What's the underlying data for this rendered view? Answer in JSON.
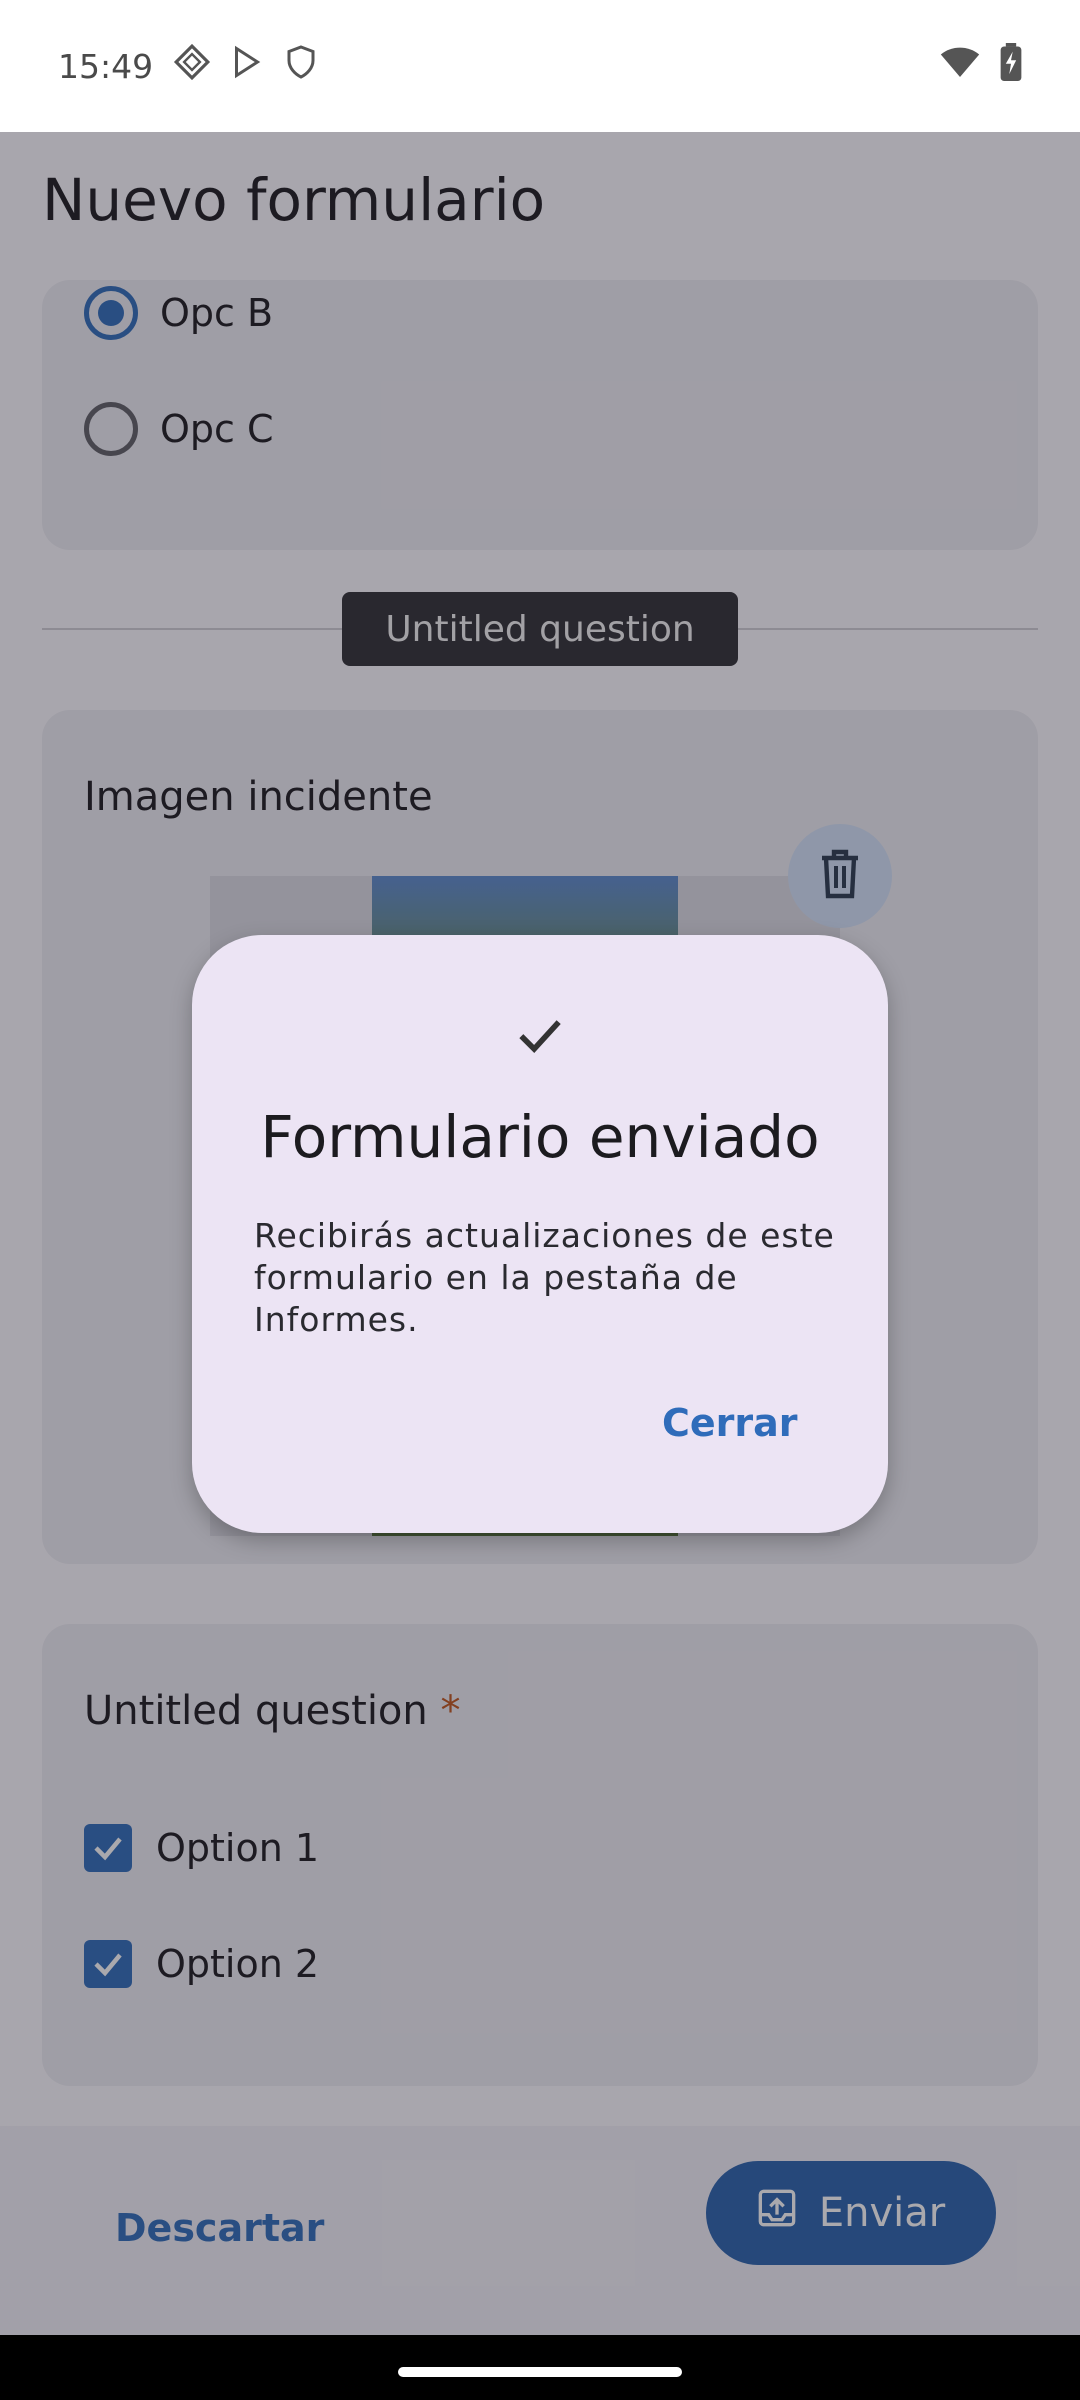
{
  "status_bar": {
    "time": "15:49",
    "icons": [
      "diamond-icon",
      "play-store-icon",
      "shield-icon",
      "wifi-icon",
      "battery-icon"
    ]
  },
  "app": {
    "title": "Nuevo formulario"
  },
  "radio_question": {
    "options": [
      {
        "label": "Opc B",
        "selected": true
      },
      {
        "label": "Opc C",
        "selected": false
      }
    ]
  },
  "section_chip": {
    "label": "Untitled question"
  },
  "image_question": {
    "title": "Imagen incidente",
    "delete_icon": "trash-icon"
  },
  "checkbox_question": {
    "title": "Untitled question",
    "required_mark": "*",
    "options": [
      {
        "label": "Option 1",
        "checked": true
      },
      {
        "label": "Option 2",
        "checked": true
      }
    ]
  },
  "bottom_bar": {
    "discard_label": "Descartar",
    "send_label": "Enviar",
    "send_icon": "upload-icon"
  },
  "dialog": {
    "icon": "check-icon",
    "title": "Formulario enviado",
    "body": "Recibirás actualizaciones de este formulario en la pestaña de Informes.",
    "close_label": "Cerrar"
  },
  "colors": {
    "primary": "#2f6cba",
    "dialog_bg": "#ece4f4",
    "required": "#c0561c"
  }
}
